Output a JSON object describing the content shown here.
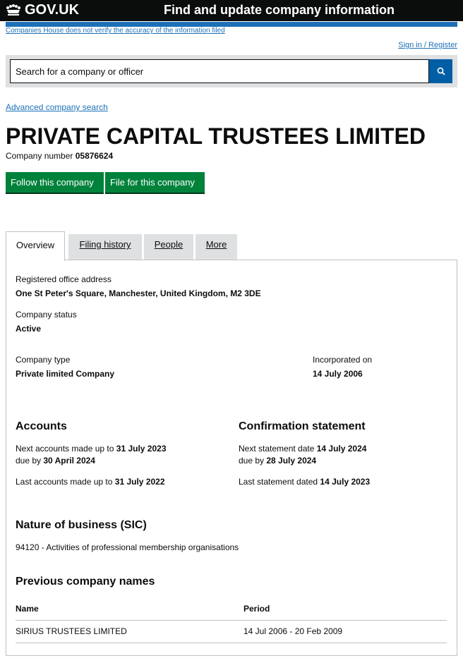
{
  "header": {
    "logo_text": "GOV.UK",
    "service_name": "Find and update company information",
    "disclaimer": "Companies House does not verify the accuracy of the information filed",
    "sign_in": "Sign in / Register"
  },
  "search": {
    "placeholder": "Search for a company or officer",
    "advanced_link": "Advanced company search"
  },
  "company": {
    "name": "PRIVATE CAPITAL TRUSTEES LIMITED",
    "number_label": "Company number",
    "number": "05876624",
    "follow_button": "Follow this company",
    "file_button": "File for this company"
  },
  "tabs": [
    {
      "label": "Overview",
      "active": true
    },
    {
      "label": "Filing history",
      "active": false
    },
    {
      "label": "People",
      "active": false
    },
    {
      "label": "More",
      "active": false
    }
  ],
  "overview": {
    "registered_office_label": "Registered office address",
    "registered_office_value": "One St Peter's Square, Manchester, United Kingdom, M2 3DE",
    "status_label": "Company status",
    "status_value": "Active",
    "type_label": "Company type",
    "type_value": "Private limited Company",
    "incorporated_label": "Incorporated on",
    "incorporated_value": "14 July 2006"
  },
  "accounts": {
    "heading": "Accounts",
    "next_prefix": "Next accounts made up to",
    "next_date": "31 July 2023",
    "due_prefix": "due by",
    "due_date": "30 April 2024",
    "last_prefix": "Last accounts made up to",
    "last_date": "31 July 2022"
  },
  "confirmation": {
    "heading": "Confirmation statement",
    "next_prefix": "Next statement date",
    "next_date": "14 July 2024",
    "due_prefix": "due by",
    "due_date": "28 July 2024",
    "last_prefix": "Last statement dated",
    "last_date": "14 July 2023"
  },
  "nature": {
    "heading": "Nature of business (SIC)",
    "sic": "94120 - Activities of professional membership organisations"
  },
  "previous_names": {
    "heading": "Previous company names",
    "col_name": "Name",
    "col_period": "Period",
    "rows": [
      {
        "name": "SIRIUS TRUSTEES LIMITED",
        "period": "14 Jul 2006 - 20 Feb 2009"
      }
    ]
  },
  "colors": {
    "header_bg": "#0b0c0c",
    "link_blue": "#1d70b8",
    "button_green": "#00823b",
    "search_button": "#005ea5"
  }
}
